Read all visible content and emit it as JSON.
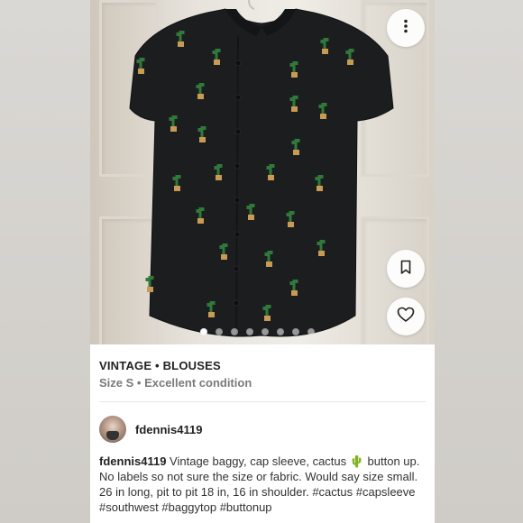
{
  "listing": {
    "brand_line": "VINTAGE • BLOUSES",
    "meta_line": "Size S • Excellent condition",
    "seller": "fdennis4119",
    "description_user": "fdennis4119",
    "description_text": " Vintage baggy, cap sleeve, cactus 🌵 button up. No labels so not sure the size or fabric. Would say size small. 26 in long, pit to pit 18 in, 16 in shoulder. #cactus #capsleeve #southwest #baggytop #buttonup"
  },
  "gallery": {
    "image_count": 8,
    "active_index": 0
  },
  "icons": {
    "more": "more-vertical-icon",
    "bookmark": "bookmark-icon",
    "like": "heart-icon"
  },
  "colors": {
    "shirt": "#1c1d1f",
    "cactus": "#2f7a3a",
    "pot": "#c99a53",
    "title": "#222222",
    "meta": "#7a7a7a"
  }
}
